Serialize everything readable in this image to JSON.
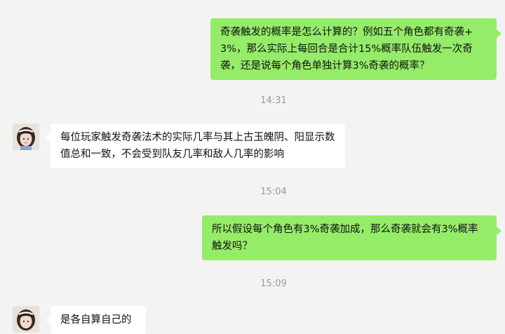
{
  "messages": [
    {
      "text": "奇袭触发的概率是怎么计算的？例如五个角色都有奇袭+3%，那么实际上每回合是合计15%概率队伍触发一次奇袭，还是说每个角色单独计算3%奇袭的概率？"
    },
    {
      "text": "每位玩家触发奇袭法术的实际几率与其上古玉魄阴、阳显示数值总和一致，不会受到队友几率和敌人几率的影响"
    },
    {
      "text": "所以假设每个角色有3%奇袭加成，那么奇袭就会有3%概率触发吗？"
    },
    {
      "text": "是各自算自己的"
    }
  ],
  "timestamps": [
    "14:31",
    "15:04",
    "15:09"
  ],
  "colors": {
    "outgoing_bubble": "#95ec69",
    "incoming_bubble": "#ffffff",
    "background": "#f3f3f3",
    "timestamp": "#9a9a9a"
  },
  "avatar_icon": "girl-avatar-icon"
}
